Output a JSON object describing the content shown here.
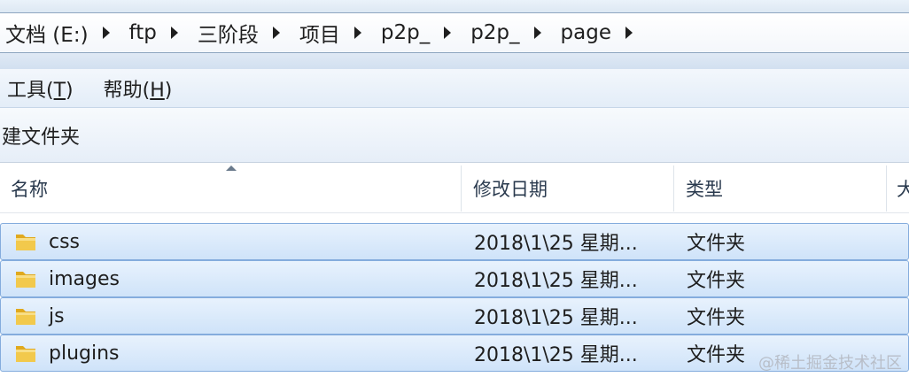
{
  "address": {
    "crumbs": [
      "文档 (E:)",
      "ftp",
      "三阶段",
      "项目",
      "p2p_",
      "p2p_",
      "page"
    ]
  },
  "menu": {
    "tools": "工具(",
    "tools_key": "T",
    "help": "帮助(",
    "help_key": "H",
    "close_paren": ")"
  },
  "toolbar": {
    "new_folder": "建文件夹"
  },
  "columns": {
    "name": "名称",
    "modified": "修改日期",
    "type": "类型",
    "size_partial": "大"
  },
  "files": [
    {
      "name": "css",
      "date": "2018\\1\\25 星期...",
      "type": "文件夹",
      "icon": "folder-icon"
    },
    {
      "name": "images",
      "date": "2018\\1\\25 星期...",
      "type": "文件夹",
      "icon": "folder-icon"
    },
    {
      "name": "js",
      "date": "2018\\1\\25 星期...",
      "type": "文件夹",
      "icon": "folder-icon"
    },
    {
      "name": "plugins",
      "date": "2018\\1\\25 星期...",
      "type": "文件夹",
      "icon": "folder-icon"
    }
  ],
  "watermark": "@稀土掘金技术社区",
  "colors": {
    "selection_fill": "#cfe3f9",
    "selection_border": "#84acdd",
    "folder_yellow": "#f2c94c"
  }
}
